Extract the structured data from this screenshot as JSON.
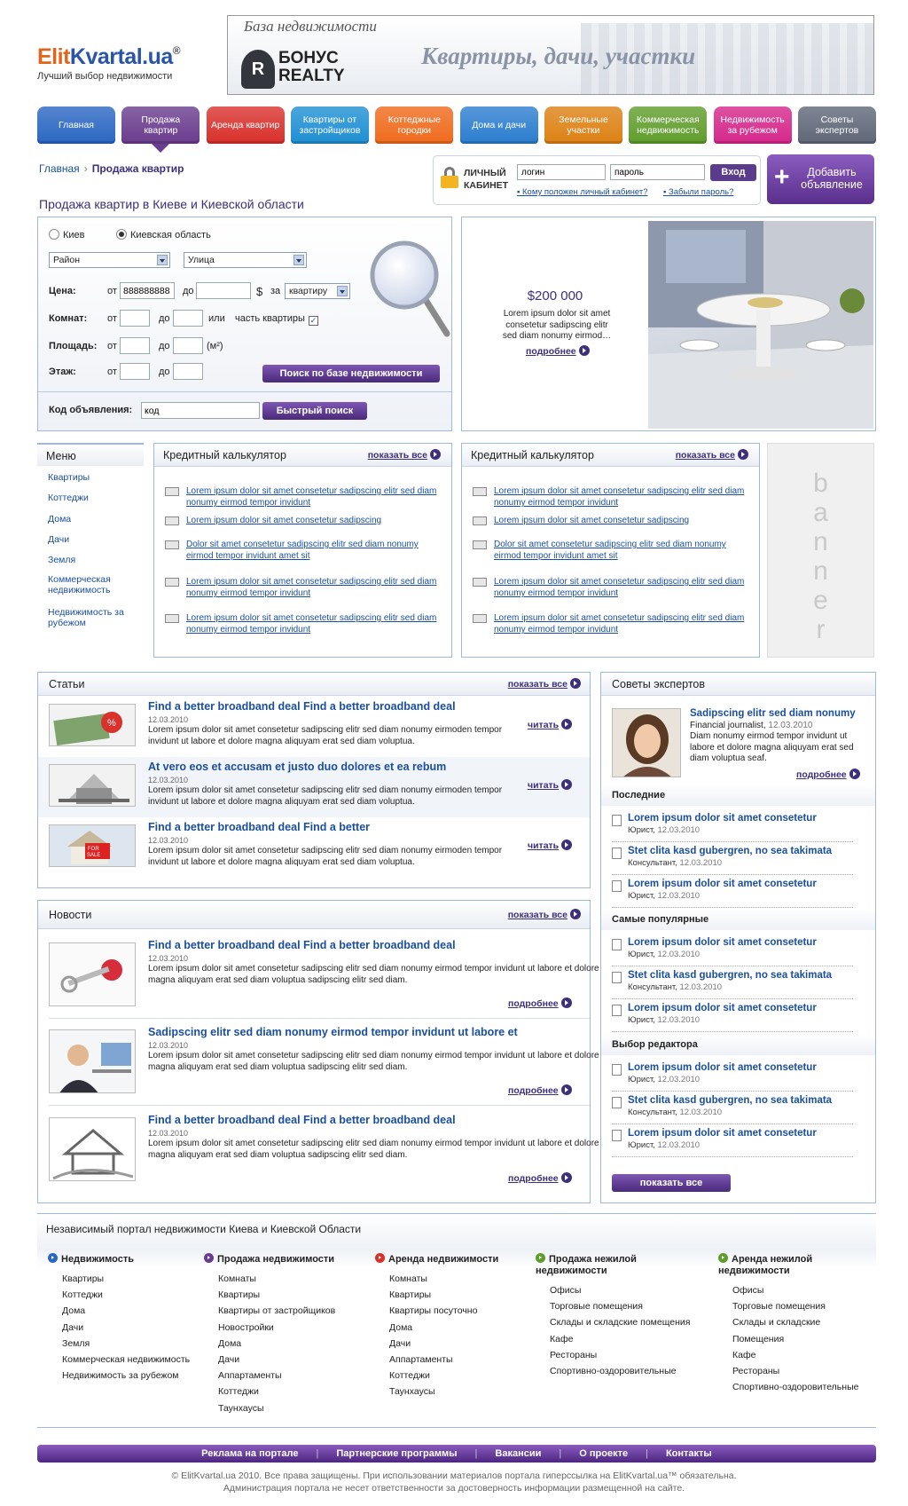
{
  "header": {
    "logo_part1": "Elit",
    "logo_part2": "Kvartal.ua",
    "logo_reg": "®",
    "tagline": "Лучший выбор недвижимости",
    "banner_label": "База недвижимости",
    "banner_brand": "БОНУС REALTY",
    "banner_slogan": "Квартиры, дачи, участки"
  },
  "nav": [
    {
      "label": "Главная",
      "color": "#2a67c2"
    },
    {
      "label": "Продажа квартир",
      "color": "#6a3c8e"
    },
    {
      "label": "Аренда квартир",
      "color": "#d9302b"
    },
    {
      "label": "Квартиры от застройщиков",
      "color": "#1f8fd2"
    },
    {
      "label": "Коттеджные городки",
      "color": "#ef6a1c"
    },
    {
      "label": "Дома и дачи",
      "color": "#2b7dcf"
    },
    {
      "label": "Земельные участки",
      "color": "#dd8113"
    },
    {
      "label": "Коммерческая недвижимость",
      "color": "#5f9d2b"
    },
    {
      "label": "Недвижимость за рубежом",
      "color": "#d5278a"
    },
    {
      "label": "Советы экспертов",
      "color": "#5f6778"
    }
  ],
  "breadcrumb": {
    "home": "Главная",
    "current": "Продажа квартир"
  },
  "login": {
    "title": "ЛИЧНЫЙ КАБИНЕТ",
    "login_value": "логин",
    "password_value": "пароль",
    "button": "Вход",
    "link1": "Кому положен личный кабинет?",
    "link2": "Забыли пароль?"
  },
  "add_button": "Добавить объявление",
  "page_title": "Продажа квартир в Киеве и Киевской области",
  "search": {
    "radio_kiev": "Киев",
    "radio_region": "Киевская область",
    "district": "Район",
    "street": "Улица",
    "price_label": "Цена:",
    "from": "от",
    "to": "до",
    "price_from": "888888888",
    "currency": "$",
    "per": "за",
    "per_unit": "квартиру",
    "rooms_label": "Комнат:",
    "or": "или",
    "part": "часть квартиры",
    "area_label": "Площадь:",
    "area_unit": "(м²)",
    "floor_label": "Этаж:",
    "search_button": "Поиск по базе недвижимости",
    "code_label": "Код объявления:",
    "code_value": "код",
    "quick_button": "Быстрый поиск"
  },
  "featured": {
    "price": "$200 000",
    "text": "Lorem ipsum dolor sit amet consetetur sadipscing elitr sed diam nonumy eirmod…",
    "more": "подробнее"
  },
  "menu": {
    "title": "Меню",
    "items": [
      "Квартиры",
      "Коттеджи",
      "Дома",
      "Дачи",
      "Земля",
      "Коммерческая недвижимость",
      "Недвижимость за рубежом"
    ]
  },
  "calc": [
    {
      "title": "Кредитный калькулятор",
      "show_all": "показать все",
      "items": [
        "Lorem ipsum dolor sit amet consetetur sadipscing elitr sed diam nonumy eirmod tempor invidunt",
        "Lorem ipsum dolor sit amet consetetur sadipscing",
        "Dolor sit amet consetetur sadipscing elitr sed diam nonumy eirmod tempor invidunt amet sit",
        "Lorem ipsum dolor sit amet consetetur sadipscing elitr sed diam nonumy eirmod tempor invidunt",
        "Lorem ipsum dolor sit amet consetetur sadipscing elitr sed diam nonumy eirmod tempor invidunt"
      ]
    },
    {
      "title": "Кредитный калькулятор",
      "show_all": "показать все",
      "items": [
        "Lorem ipsum dolor sit amet consetetur sadipscing elitr sed diam nonumy eirmod tempor invidunt",
        "Lorem ipsum dolor sit amet consetetur sadipscing",
        "Dolor sit amet consetetur sadipscing elitr sed diam nonumy eirmod tempor invidunt amet sit",
        "Lorem ipsum dolor sit amet consetetur sadipscing elitr sed diam nonumy eirmod tempor invidunt",
        "Lorem ipsum dolor sit amet consetetur sadipscing elitr sed diam nonumy eirmod tempor invidunt"
      ]
    }
  ],
  "side_banner": "banner",
  "articles": {
    "title": "Статьи",
    "show_all": "показать все",
    "read": "читать",
    "items": [
      {
        "title": "Find a better broadband deal  Find a better broadband deal",
        "date": "12.03.2010",
        "text": "Lorem ipsum dolor sit amet consetetur sadipscing elitr sed diam nonumy eirmoden tempor invidunt ut labore et dolore magna aliquyam erat sed diam voluptua."
      },
      {
        "title": "At vero eos et accusam et justo duo dolores et ea rebum",
        "date": "12.03.2010",
        "text": "Lorem ipsum dolor sit amet consetetur sadipscing elitr sed diam nonumy eirmoden tempor invidunt ut labore et dolore magna aliquyam erat sed diam voluptua."
      },
      {
        "title": "Find a better broadband deal  Find a better",
        "date": "12.03.2010",
        "text": "Lorem ipsum dolor sit amet consetetur sadipscing elitr sed diam nonumy eirmoden tempor invidunt ut labore et dolore magna aliquyam erat sed diam voluptua."
      }
    ]
  },
  "news": {
    "title": "Новости",
    "show_all": "показать все",
    "more": "подробнее",
    "items": [
      {
        "title": "Find a better broadband deal  Find a better broadband deal",
        "date": "12.03.2010",
        "text": "Lorem ipsum dolor sit amet consetetur sadipscing elitr sed diam nonumy eirmod tempor invidunt ut labore et dolore magna aliquyam erat sed diam voluptua sadipscing elitr sed diam."
      },
      {
        "title": "Sadipscing elitr sed diam nonumy eirmod tempor invidunt ut labore et",
        "date": "12.03.2010",
        "text": "Lorem ipsum dolor sit amet consetetur sadipscing elitr sed diam nonumy eirmod tempor invidunt ut labore et dolore magna aliquyam erat sed diam voluptua sadipscing elitr sed diam."
      },
      {
        "title": "Find a better broadband deal  Find a better broadband deal",
        "date": "12.03.2010",
        "text": "Lorem ipsum dolor sit amet consetetur sadipscing elitr sed diam nonumy eirmod tempor invidunt ut labore et dolore magna aliquyam erat sed diam voluptua sadipscing elitr sed diam."
      }
    ]
  },
  "experts": {
    "title": "Советы экспертов",
    "featured": {
      "name": "Sadipscing elitr sed diam nonumy",
      "role": "Financial journalist,",
      "date": "12.03.2010",
      "text": "Diam nonumy eirmod tempor invidunt ut labore et dolore magna aliquyam erat sed diam voluptua seaf.",
      "more": "подробнее"
    },
    "sections": [
      {
        "title": "Последние",
        "items": [
          {
            "name": "Lorem ipsum dolor sit amet consetetur",
            "role": "Юрист,",
            "date": "12.03.2010"
          },
          {
            "name": "Stet clita kasd gubergren, no sea takimata",
            "role": "Консультант,",
            "date": "12.03.2010"
          },
          {
            "name": "Lorem ipsum dolor sit amet consetetur",
            "role": "Юрист,",
            "date": "12.03.2010"
          }
        ]
      },
      {
        "title": "Самые популярные",
        "items": [
          {
            "name": "Lorem ipsum dolor sit amet consetetur",
            "role": "Юрист,",
            "date": "12.03.2010"
          },
          {
            "name": "Stet clita kasd gubergren, no sea takimata",
            "role": "Консультант,",
            "date": "12.03.2010"
          },
          {
            "name": "Lorem ipsum dolor sit amet consetetur",
            "role": "Юрист,",
            "date": "12.03.2010"
          }
        ]
      },
      {
        "title": "Выбор редактора",
        "items": [
          {
            "name": "Lorem ipsum dolor sit amet consetetur",
            "role": "Юрист,",
            "date": "12.03.2010"
          },
          {
            "name": "Stet clita kasd gubergren, no sea takimata",
            "role": "Консультант,",
            "date": "12.03.2010"
          },
          {
            "name": "Lorem ipsum dolor sit amet consetetur",
            "role": "Юрист,",
            "date": "12.03.2010"
          }
        ]
      }
    ],
    "show_all": "показать все"
  },
  "footer": {
    "title": "Независимый портал недвижимости Киева и Киевской Области",
    "columns": [
      {
        "title": "Недвижимость",
        "color": "#2a67c2",
        "items": [
          "Квартиры",
          "Коттеджи",
          "Дома",
          "Дачи",
          "Земля",
          "Коммерческая недвижимость",
          "Недвижимость за рубежом"
        ]
      },
      {
        "title": "Продажа недвижимости",
        "color": "#6a3c8e",
        "items": [
          "Комнаты",
          "Квартиры",
          "Квартиры от застройщиков",
          "Новостройки",
          "Дома",
          "Дачи",
          "Аппартаменты",
          "Коттеджи",
          "Таунхаусы"
        ]
      },
      {
        "title": "Аренда недвижимости",
        "color": "#d9302b",
        "items": [
          "Комнаты",
          "Квартиры",
          "Квартиры посуточно",
          "Дома",
          "Дачи",
          "Аппартаменты",
          "Коттеджи",
          "Таунхаусы"
        ]
      },
      {
        "title": "Продажа нежилой недвижимости",
        "color": "#5f9d2b",
        "items": [
          "Офисы",
          "Торговые помещения",
          "Склады и складские помещения",
          "Кафе",
          "Рестораны",
          "Спортивно-оздоровительные"
        ]
      },
      {
        "title": "Аренда нежилой недвижимости",
        "color": "#5f9d2b",
        "items": [
          "Офисы",
          "Торговые помещения",
          "Склады и складские",
          "Помещения",
          "Кафе",
          "Рестораны",
          "Спортивно-оздоровительные"
        ]
      }
    ],
    "bar": [
      "Реклама на портале",
      "Партнерские программы",
      "Вакансии",
      "О проекте",
      "Контакты"
    ],
    "copyright1": "© ElitKvartal.ua 2010. Все права защищены. При использовании материалов портала гиперссылка на ElitKvartal.ua™ обязательна.",
    "copyright2": "Администрация портала не несет ответственности за достоверность информации размещенной на сайте."
  }
}
